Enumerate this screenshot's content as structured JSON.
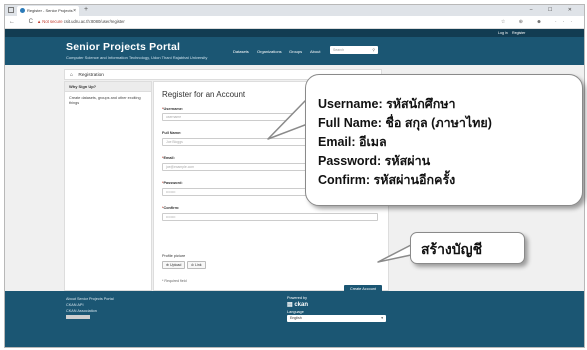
{
  "browser": {
    "tab_title": "Register - Senior Projects Portal",
    "tab_close": "×",
    "new_tab": "+",
    "window_controls": "– ☐ ✕",
    "nav_icons": "← C",
    "url_warning": "▲ Not secure",
    "url": "csit.udru.ac.th:8080/user/register",
    "right_icons": "☆ ⊕ ☻ ···"
  },
  "site": {
    "account_links": {
      "login": "Log in",
      "register": "Register"
    },
    "title": "Senior Projects Portal",
    "subtitle": "Computer Science and Information Technology, Udon Thani Rajabhat University",
    "nav": {
      "datasets": "Datasets",
      "organizations": "Organizations",
      "groups": "Groups",
      "about": "About"
    },
    "search_placeholder": "Search",
    "breadcrumb": "Registration",
    "sidebar": {
      "heading": "Why Sign Up?",
      "text": "Create datasets, groups and other exciting things"
    },
    "form": {
      "title": "Register for an Account",
      "username_label": "Username:",
      "username_placeholder": "username",
      "fullname_label": "Full Name:",
      "fullname_placeholder": "Joe Bloggs",
      "email_label": "Email:",
      "email_placeholder": "joe@example.com",
      "password_label": "Password:",
      "password_placeholder": "••••••••",
      "confirm_label": "Confirm:",
      "confirm_placeholder": "••••••••",
      "picture_label": "Profile picture",
      "upload_label": "⊕ Upload",
      "link_label": "⊘ Link",
      "required_note": "* Required field",
      "submit_label": "Create Account",
      "required_mark": "*"
    },
    "footer": {
      "about": "About Senior Projects Portal",
      "api": "CKAN API",
      "association": "CKAN Association",
      "powered_by": "Powered by",
      "ckan": "▤ ckan",
      "language_label": "Language",
      "language_value": "English",
      "caret": "▾"
    }
  },
  "annotations": {
    "lines": [
      "Username:  รหัสนักศึกษา",
      "Full Name: ชื่อ สกุล (ภาษาไทย)",
      "Email: อีเมล",
      "Password: รหัสผ่าน",
      "Confirm: รหัสผ่านอีกครั้ง"
    ],
    "button_note": "สร้างบัญชี"
  }
}
